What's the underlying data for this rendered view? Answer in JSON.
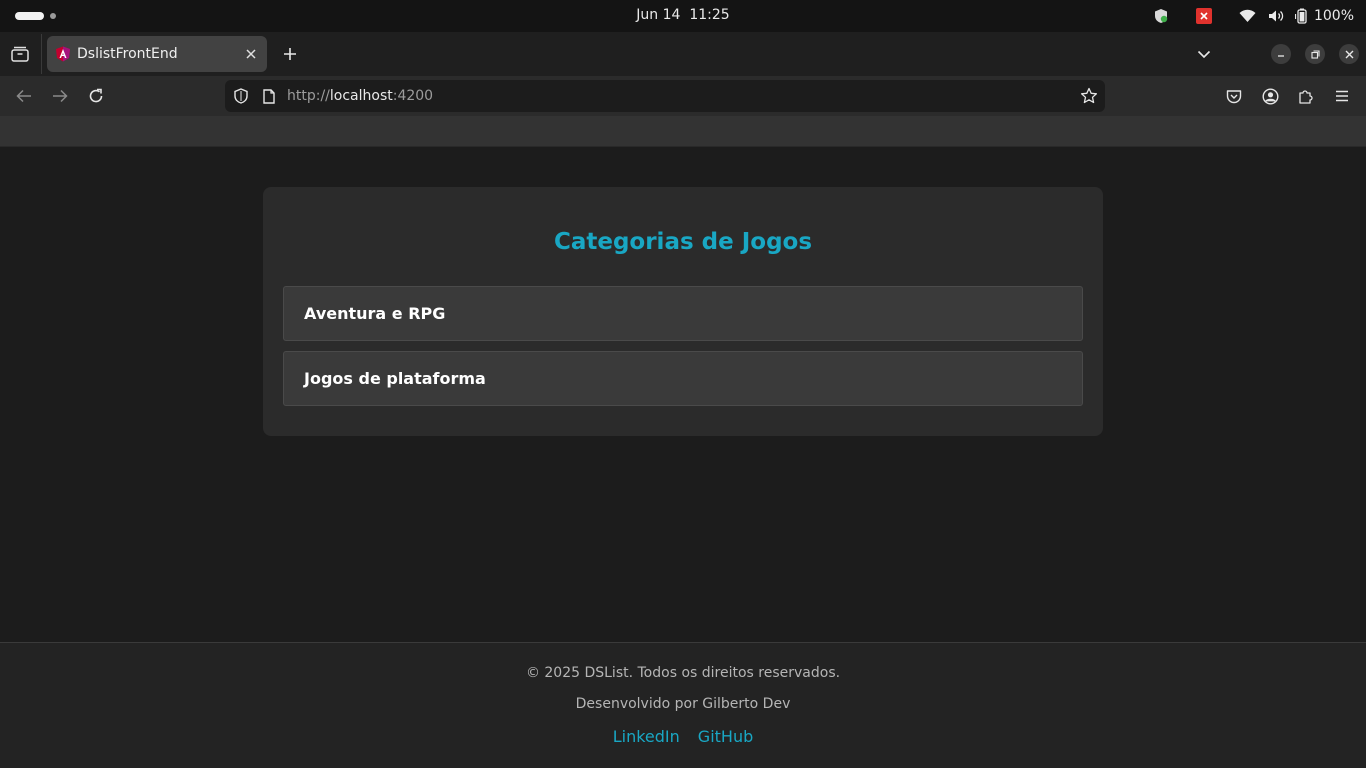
{
  "os": {
    "clock": "Jun 14  11:25",
    "battery": "100%"
  },
  "browser": {
    "tab_title": "DslistFrontEnd",
    "url_scheme": "http://",
    "url_host": "localhost",
    "url_port": ":4200"
  },
  "page": {
    "card_title": "Categorias de Jogos",
    "categories": [
      {
        "name": "Aventura e RPG"
      },
      {
        "name": "Jogos de plataforma"
      }
    ],
    "footer": {
      "copyright": "© 2025 DSList. Todos os direitos reservados.",
      "developer": "Desenvolvido por Gilberto Dev",
      "links": [
        "LinkedIn",
        "GitHub"
      ]
    }
  },
  "colors": {
    "accent": "#19a7c4",
    "page_bg": "#1c1c1c",
    "card_bg": "#2b2b2b",
    "item_bg": "#3a3a3a"
  }
}
